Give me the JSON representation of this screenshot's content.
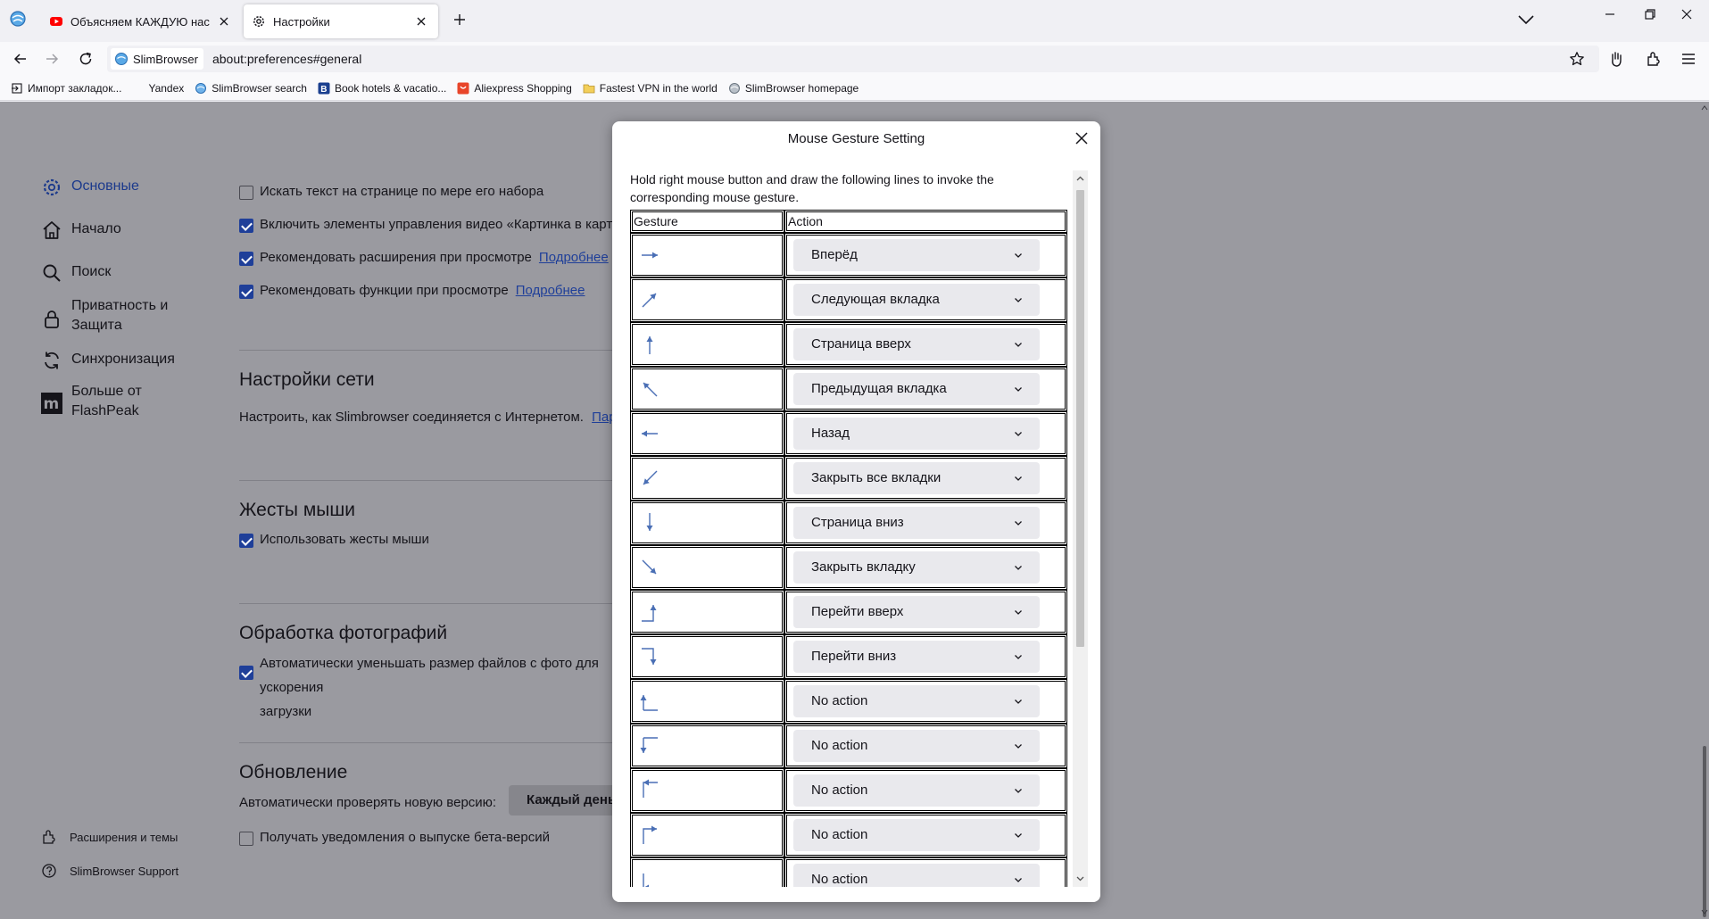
{
  "tabs": [
    {
      "label": "Объясняем КАЖДУЮ настройку",
      "icon": "youtube-icon",
      "active": false
    },
    {
      "label": "Настройки",
      "icon": "gear-icon",
      "active": true
    }
  ],
  "toolbar": {
    "identity_label": "SlimBrowser",
    "url": "about:preferences#general"
  },
  "bookmarks": [
    {
      "label": "Импорт закладок...",
      "icon": "import-icon"
    },
    {
      "label": "Yandex",
      "icon": "yandex-icon"
    },
    {
      "label": "SlimBrowser search",
      "icon": "search-globe-icon"
    },
    {
      "label": "Book hotels & vacatio...",
      "icon": "booking-icon"
    },
    {
      "label": "Aliexpress Shopping",
      "icon": "aliexpress-icon"
    },
    {
      "label": "Fastest VPN in the world",
      "icon": "vpn-icon"
    },
    {
      "label": "SlimBrowser homepage",
      "icon": "slimbrowser-icon"
    }
  ],
  "sidebar": {
    "items": [
      {
        "label": "Основные",
        "icon": "gear-icon",
        "selected": true
      },
      {
        "label": "Начало",
        "icon": "home-icon"
      },
      {
        "label": "Поиск",
        "icon": "search-icon"
      },
      {
        "label": "Приватность и Защита",
        "icon": "lock-icon"
      },
      {
        "label": "Синхронизация",
        "icon": "sync-icon"
      },
      {
        "label": "Больше от FlashPeak",
        "icon": "flashpeak-icon"
      }
    ],
    "footer": [
      {
        "label": "Расширения и темы",
        "icon": "puzzle-icon"
      },
      {
        "label": "SlimBrowser Support",
        "icon": "help-icon"
      }
    ]
  },
  "content": {
    "options": [
      {
        "label": "Искать текст на странице по мере его набора",
        "checked": false
      },
      {
        "label": "Включить элементы управления видео «Картинка в картинке»",
        "checked": true
      },
      {
        "label": "Рекомендовать расширения при просмотре",
        "checked": true,
        "link": "Подробнее"
      },
      {
        "label": "Рекомендовать функции при просмотре",
        "checked": true,
        "link": "Подробнее"
      }
    ],
    "network": {
      "title": "Настройки сети",
      "text": "Настроить, как Slimbrowser соединяется с Интернетом.",
      "link": "Параметры..."
    },
    "gestures": {
      "title": "Жесты мыши",
      "option": "Использовать жесты мыши",
      "checked": true
    },
    "photos": {
      "title": "Обработка фотографий",
      "option_line1": "Автоматически уменьшать размер файлов с фото для ускорения",
      "option_line2": "загрузки",
      "checked": true
    },
    "update": {
      "title": "Обновление",
      "text": "Автоматически проверять новую версию:",
      "button": "Каждый день",
      "beta_option": "Получать уведомления о выпуске бета-версий",
      "beta_checked": false
    }
  },
  "dialog": {
    "title": "Mouse Gesture Setting",
    "intro": "Hold right mouse button and draw the following lines to invoke the corresponding mouse gesture.",
    "columns": [
      "Gesture",
      "Action"
    ],
    "rows": [
      {
        "gesture": "arrow-right-icon",
        "action": "Вперёд"
      },
      {
        "gesture": "arrow-up-right-icon",
        "action": "Следующая вкладка"
      },
      {
        "gesture": "arrow-up-icon",
        "action": "Страница вверх"
      },
      {
        "gesture": "arrow-up-left-icon",
        "action": "Предыдущая вкладка"
      },
      {
        "gesture": "arrow-left-icon",
        "action": "Назад"
      },
      {
        "gesture": "arrow-down-left-icon",
        "action": "Закрыть все вкладки"
      },
      {
        "gesture": "arrow-down-icon",
        "action": "Страница вниз"
      },
      {
        "gesture": "arrow-down-right-icon",
        "action": "Закрыть вкладку"
      },
      {
        "gesture": "right-then-up-icon",
        "action": "Перейти вверх"
      },
      {
        "gesture": "right-then-down-icon",
        "action": "Перейти вниз"
      },
      {
        "gesture": "up-then-right-icon",
        "action": "No action"
      },
      {
        "gesture": "down-then-right-icon",
        "action": "No action"
      },
      {
        "gesture": "left-then-down-icon",
        "action": "No action"
      },
      {
        "gesture": "up-then-right-arrow-icon",
        "action": "No action"
      },
      {
        "gesture": "left-then-up-icon",
        "action": "No action"
      }
    ]
  },
  "colors": {
    "accent": "#1f3f99",
    "overlay": "#9a9aa0",
    "gesture_arrow": "#4a6fb5"
  }
}
